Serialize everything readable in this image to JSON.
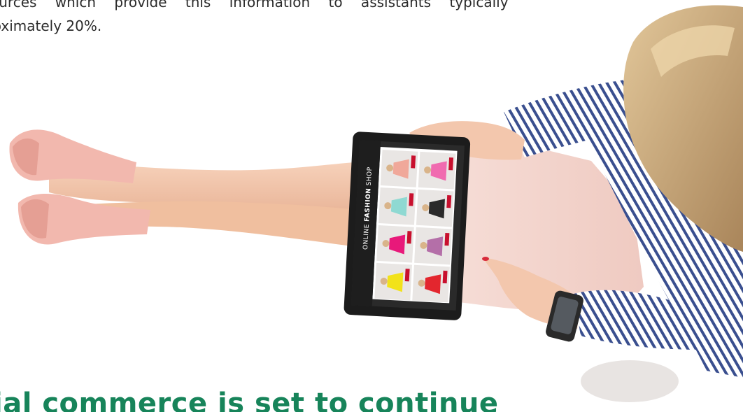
{
  "article": {
    "paragraph_line_1": "ources which provide this information to assistants typically",
    "paragraph_line_2": "roximately 20%.",
    "headline": "ial commerce is set to continue"
  },
  "tablet": {
    "shop_title_part_1": "ONLINE ",
    "shop_title_part_2": "FASHION",
    "shop_title_part_3": " SHOP"
  },
  "colors": {
    "headline": "#17845a",
    "paragraph": "#2b2b2b",
    "shirt_stripe": "#3a4f8f",
    "skirt": "#f4d9d3",
    "shoes": "#f2b8ae",
    "skin": "#f3c7ad",
    "hair": "#c9a878",
    "tablet_frame": "#1c1c1c"
  },
  "product_grid": {
    "dress_colors": [
      "#f0a89a",
      "#f06bb0",
      "#8fd9d2",
      "#2a2a2a",
      "#e8197a",
      "#b46fa8",
      "#f2e21a",
      "#e3262e"
    ]
  },
  "icons": [
    "smartwatch-icon"
  ]
}
